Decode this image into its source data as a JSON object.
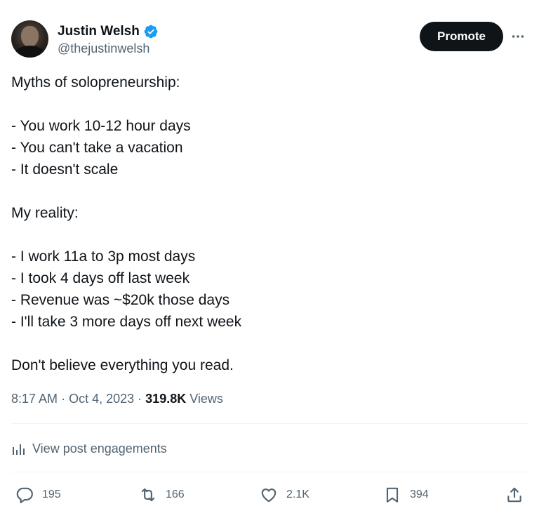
{
  "author": {
    "name": "Justin Welsh",
    "handle": "@thejustinwelsh"
  },
  "header": {
    "promote_label": "Promote",
    "more_label": "···"
  },
  "body_lines": [
    "Myths of solopreneurship:",
    "",
    "- You work 10-12 hour days",
    "- You can't take a vacation",
    "- It doesn't scale",
    "",
    "My reality:",
    "",
    "- I work 11a to 3p most days",
    "- I took 4 days off last week",
    "- Revenue was ~$20k those days",
    "- I'll take 3 more days off next week",
    "",
    "Don't believe everything you read."
  ],
  "meta": {
    "time": "8:17 AM",
    "separator": "·",
    "date": "Oct 4, 2023",
    "views_count": "319.8K",
    "views_label": "Views"
  },
  "engagements": {
    "label": "View post engagements"
  },
  "actions": {
    "replies": "195",
    "reposts": "166",
    "likes": "2.1K",
    "bookmarks": "394"
  },
  "colors": {
    "text_primary": "#0f1419",
    "text_secondary": "#536471",
    "verified_blue": "#1d9bf0",
    "divider": "#eff3f4",
    "promote_bg": "#0f1419"
  },
  "icons": {
    "verified": "verified-badge-icon",
    "more": "more-dots-icon",
    "engagements": "bar-chart-icon",
    "reply": "reply-icon",
    "repost": "repost-icon",
    "like": "heart-icon",
    "bookmark": "bookmark-icon",
    "share": "share-icon"
  }
}
